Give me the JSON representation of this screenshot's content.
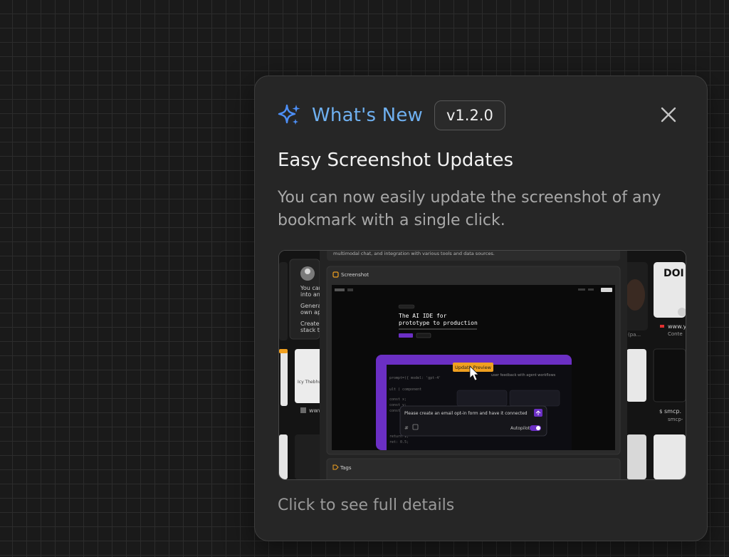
{
  "header": {
    "title": "What's New",
    "version": "v1.2.0"
  },
  "feature": {
    "title": "Easy Screenshot Updates",
    "description": "You can now easily update the screenshot of any bookmark with a single click."
  },
  "preview": {
    "top_text": "multimodal chat, and integration with various tools and data sources.",
    "screenshot_label": "Screenshot",
    "hero_line1": "The AI IDE for",
    "hero_line2": "prototype to production",
    "update_button": "Update Preview",
    "prompt_text": "Please create an email opt-in form and have it connected",
    "autopilot_label": "Autopilot",
    "tags_label": "Tags",
    "left_card_lines": [
      "You can",
      "into any",
      "Generate",
      "own app",
      "Create y",
      "stack th"
    ],
    "left_url": "www",
    "right_card_text": "DOI",
    "right_url": "www.y",
    "right_sub": "Conte",
    "right_url2": "smcp.",
    "right_sub2": "smcp-"
  },
  "footer": {
    "link": "Click to see full details"
  },
  "colors": {
    "accent_blue": "#6fb0f0",
    "purple": "#6b2fc4",
    "orange": "#f0a020"
  }
}
